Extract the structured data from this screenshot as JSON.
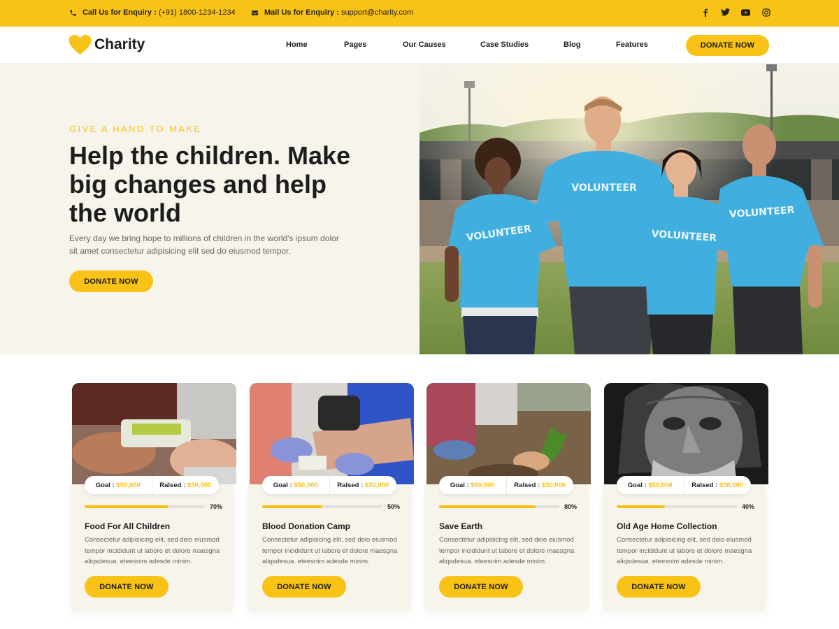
{
  "topbar": {
    "phone_label": "Call Us for Enquiry :",
    "phone_value": "(+91) 1800-1234-1234",
    "mail_label": "Mail Us for Enquiry :",
    "mail_value": "support@charity.com",
    "socials": [
      "facebook-icon",
      "twitter-icon",
      "youtube-icon",
      "instagram-icon"
    ]
  },
  "brand": {
    "name": "Charity",
    "accent_color": "#f9c216",
    "hero_bg": "#f7f4ec"
  },
  "nav": {
    "items": [
      "Home",
      "Pages",
      "Our Causes",
      "Case Studies",
      "Blog",
      "Features"
    ],
    "donate_label": "DONATE NOW"
  },
  "hero": {
    "eyebrow": "GIVE A HAND TO MAKE",
    "title": "Help the children. Make big changes and help the world",
    "subtitle": "Every day we bring hope to millions of children in the world's ipsum dolor sit amet consectetur adipisicing elit sed do eiusmod tempor.",
    "donate_label": "DONATE NOW",
    "shirt_text": "VOLUNTEER"
  },
  "causes": [
    {
      "title": "Food For All Children",
      "goal_label": "Goal :",
      "goal": "$50,000",
      "raised_label": "Ralsed :",
      "raised": "$30,000",
      "progress": 70,
      "progress_label": "70%",
      "desc": "Consectetur adipisicing elit, sed deio eiusmod tempor incididunt ut labore et dolore maesgna aliqsdesua. eteesnim adesde minim.",
      "donate_label": "DONATE NOW"
    },
    {
      "title": "Blood Donation Camp",
      "goal_label": "Goal :",
      "goal": "$50,000",
      "raised_label": "Ralsed :",
      "raised": "$30,000",
      "progress": 50,
      "progress_label": "50%",
      "desc": "Consectetur adipisicing elit, sed deio eiusmod tempor incididunt ut labore et dolore maesgna aliqsdesua. eteesnim adesde minim.",
      "donate_label": "DONATE NOW"
    },
    {
      "title": "Save Earth",
      "goal_label": "Goal :",
      "goal": "$50,000",
      "raised_label": "Ralsed :",
      "raised": "$30,000",
      "progress": 80,
      "progress_label": "80%",
      "desc": "Consectetur adipisicing elit, sed deio eiusmod tempor incididunt ut labore et dolore maesgna aliqsdesua. eteesnim adesde minim.",
      "donate_label": "DONATE NOW"
    },
    {
      "title": "Old Age Home Collection",
      "goal_label": "Goal :",
      "goal": "$50,000",
      "raised_label": "Ralsed :",
      "raised": "$30,000",
      "progress": 40,
      "progress_label": "40%",
      "desc": "Consectetur adipisicing elit, sed deio eiusmod tempor incididunt ut labore et dolore maesgna aliqsdesua. eteesnim adesde minim.",
      "donate_label": "DONATE NOW"
    }
  ]
}
